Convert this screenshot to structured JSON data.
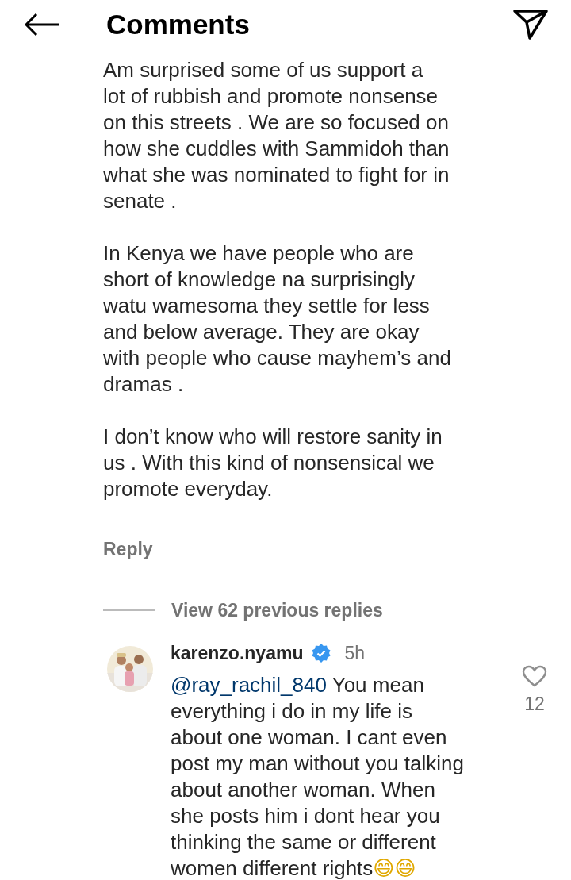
{
  "header": {
    "title": "Comments"
  },
  "comment": {
    "paragraphs": [
      {
        "lines": [
          "Am surprised some of us support a",
          "lot of rubbish and promote nonsense",
          "on this streets . We are so focused on",
          "how she cuddles with Sammidoh than",
          "what she was nominated to fight for in",
          "senate ."
        ]
      },
      {
        "lines": [
          "In Kenya we have people who are",
          "short of knowledge na surprisingly",
          "watu wamesoma they settle for less",
          "and below average. They are okay",
          "with people who cause mayhem’s and",
          "dramas ."
        ]
      },
      {
        "lines": [
          "I don’t know who will restore sanity in",
          "us . With this kind of nonsensical we",
          "promote everyday."
        ]
      }
    ],
    "reply_label": "Reply"
  },
  "view_replies": "View 62 previous replies",
  "reply": {
    "username": "karenzo.nyamu",
    "verified": true,
    "time": "5h",
    "mention": "@ray_rachil_840",
    "lines": [
      " You mean",
      "everything i do in my life is",
      "about one woman. I cant even",
      "post my man without you talking",
      "about another woman. When",
      "she posts him i dont hear you",
      "thinking the same or different",
      "women different rights😄😄"
    ],
    "liked": false,
    "likes": "12"
  }
}
